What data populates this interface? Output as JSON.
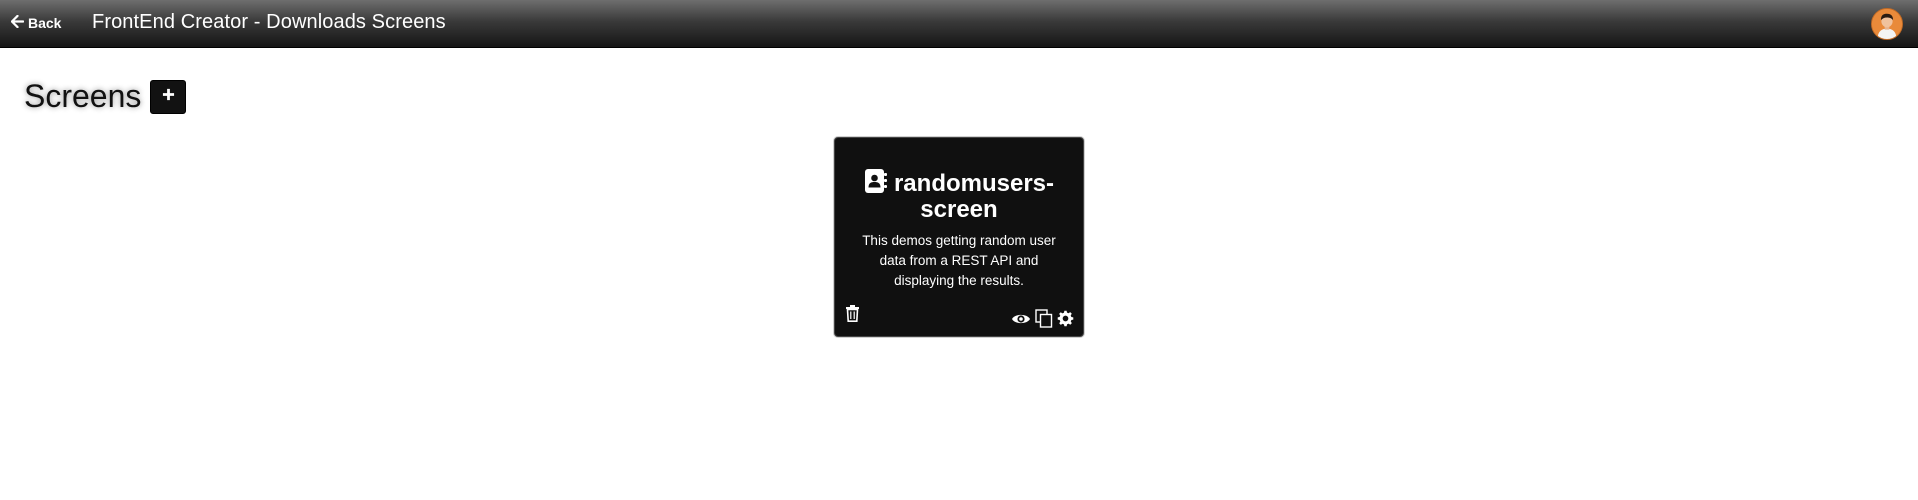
{
  "header": {
    "back_label": "Back",
    "title": "FrontEnd Creator - Downloads Screens",
    "avatar_icon": "user-avatar"
  },
  "main": {
    "heading": "Screens",
    "add_button_icon": "plus-icon"
  },
  "screens": [
    {
      "name": "randomusers-screen",
      "description": "This demos getting random user data from a REST API and displaying the results.",
      "icon": "address-book-icon",
      "actions": [
        "delete",
        "preview",
        "duplicate",
        "settings"
      ]
    }
  ],
  "colors": {
    "topbar_top": "#6e6e6e",
    "topbar_bottom": "#151515",
    "card_bg": "#101010",
    "button_bg": "#121212",
    "avatar_bg": "#e98a3a"
  }
}
